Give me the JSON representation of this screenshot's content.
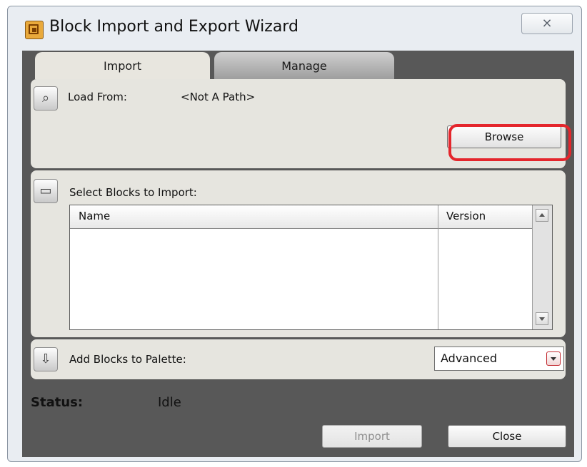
{
  "window": {
    "title": "Block Import and Export Wizard",
    "close_glyph": "⨯"
  },
  "tabs": [
    {
      "label": "Import",
      "active": true
    },
    {
      "label": "Manage",
      "active": false
    }
  ],
  "load_from": {
    "label": "Load From:",
    "path": "<Not A Path>",
    "browse_label": "Browse"
  },
  "select_blocks": {
    "label": "Select Blocks to Import:",
    "columns": [
      "Name",
      "Version"
    ],
    "rows": []
  },
  "add_blocks": {
    "label": "Add Blocks to Palette:",
    "selected": "Advanced"
  },
  "status": {
    "label": "Status:",
    "value": "Idle"
  },
  "footer": {
    "import_label": "Import",
    "close_label": "Close"
  },
  "colors": {
    "highlight": "#e4262c",
    "panel_bg": "#585858",
    "section_bg": "#e6e5df"
  }
}
